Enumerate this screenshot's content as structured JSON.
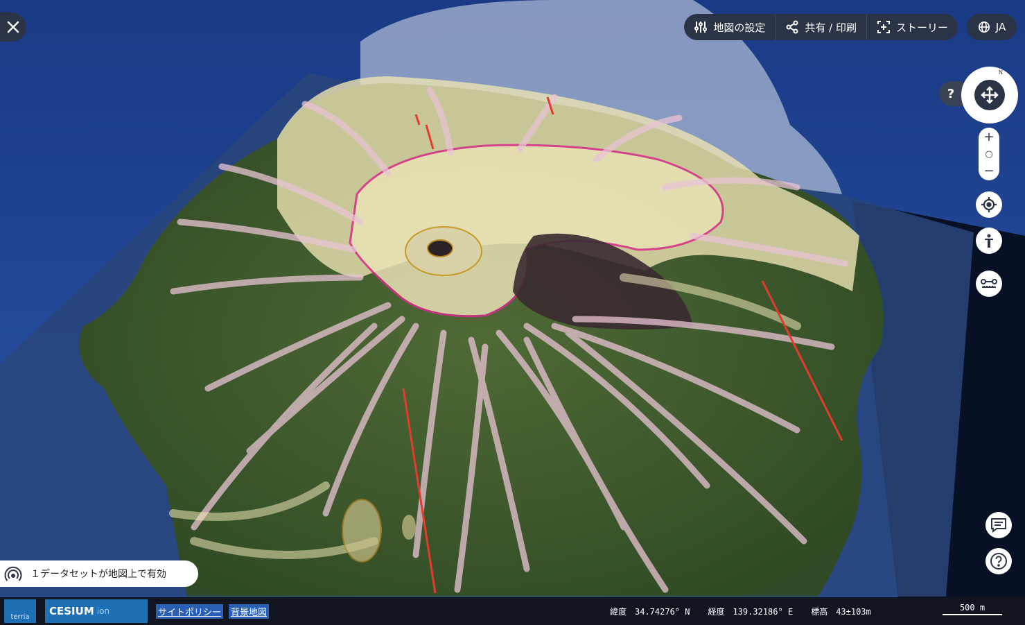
{
  "toolbar": {
    "map_settings": "地図の設定",
    "share_print": "共有 / 印刷",
    "story": "ストーリー",
    "language": "JA"
  },
  "nav": {
    "help": "?",
    "compass_north": "N",
    "zoom_in": "+",
    "zoom_reset": "○",
    "zoom_out": "−"
  },
  "workbench": {
    "active_datasets": "１データセットが地図上で有効"
  },
  "footer": {
    "terria_logo": "terria",
    "cesium_logo": "CESIUM",
    "cesium_ion": "ion",
    "site_policy": "サイトポリシー",
    "basemap": "背景地図",
    "latitude": "緯度　34.74276° N",
    "longitude": "経度　139.32186° E",
    "elevation": "標高　43±103m",
    "scale": "500 m"
  },
  "colors": {
    "ui_dark": "#2b3346",
    "ocean": "#1f3f8a",
    "geology_pink": "#e9c4d4",
    "geology_cream": "#efe6b8",
    "fault_red": "#e53a2e",
    "crater_magenta": "#d62c8a"
  },
  "icons": {
    "close": "close-icon",
    "settings": "sliders-icon",
    "share": "share-icon",
    "story": "story-icon",
    "language": "globe-icon",
    "compass": "move-icon",
    "locate": "crosshair-icon",
    "accessibility": "person-icon",
    "measure": "ruler-icon",
    "feedback": "chat-icon",
    "help": "help-icon",
    "dataset": "signal-icon"
  }
}
